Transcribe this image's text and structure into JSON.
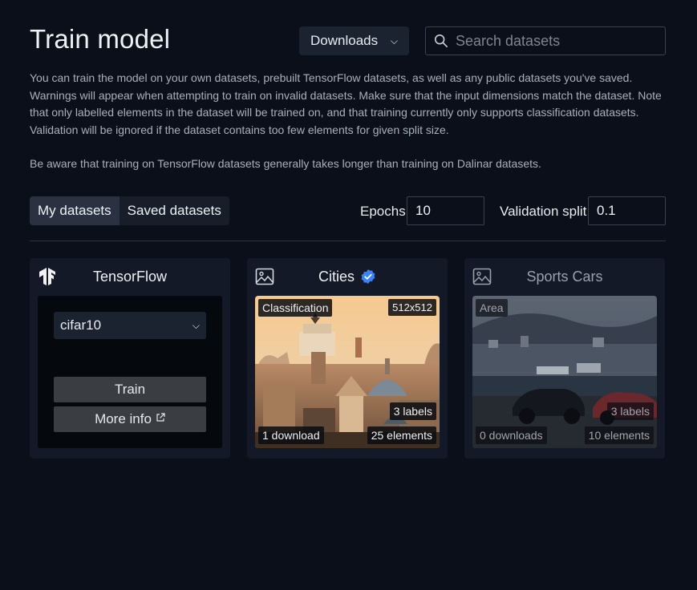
{
  "page": {
    "title": "Train model",
    "sort": {
      "selected": "Downloads"
    },
    "search": {
      "placeholder": "Search datasets",
      "value": ""
    },
    "description": [
      "You can train the model on your own datasets, prebuilt TensorFlow datasets, as well as any public datasets you've saved. Warnings will appear when attempting to train on invalid datasets. Make sure that the input dimensions match the dataset. Note that only labelled elements in the dataset will be trained on, and that training currently only supports classification datasets. Validation will be ignored if the dataset contains too few elements for given split size.",
      "Be aware that training on TensorFlow datasets generally takes longer than training on Dalinar datasets."
    ]
  },
  "tabs": [
    {
      "label": "My datasets",
      "active": true
    },
    {
      "label": "Saved datasets",
      "active": false
    }
  ],
  "training": {
    "epochs_label": "Epochs",
    "epochs_value": "10",
    "split_label": "Validation split",
    "split_value": "0.1"
  },
  "tensorflow_card": {
    "title": "TensorFlow",
    "icon": "tensorflow-logo",
    "dataset_selected": "cifar10",
    "train_label": "Train",
    "more_info_label": "More info",
    "more_info_icon": "external-link-icon"
  },
  "datasets": [
    {
      "title": "Cities",
      "verified": true,
      "icon": "image-icon",
      "type": "Classification",
      "size": "512x512",
      "labels": "3 labels",
      "downloads": "1 download",
      "elements": "25 elements"
    },
    {
      "title": "Sports Cars",
      "verified": false,
      "icon": "image-icon",
      "type": "Area",
      "labels": "3 labels",
      "downloads": "0 downloads",
      "elements": "10 elements"
    }
  ],
  "colors": {
    "background": "#0b0f19",
    "card": "#131926",
    "verified_badge": "#3b82f6",
    "button": "#3a3d42"
  }
}
